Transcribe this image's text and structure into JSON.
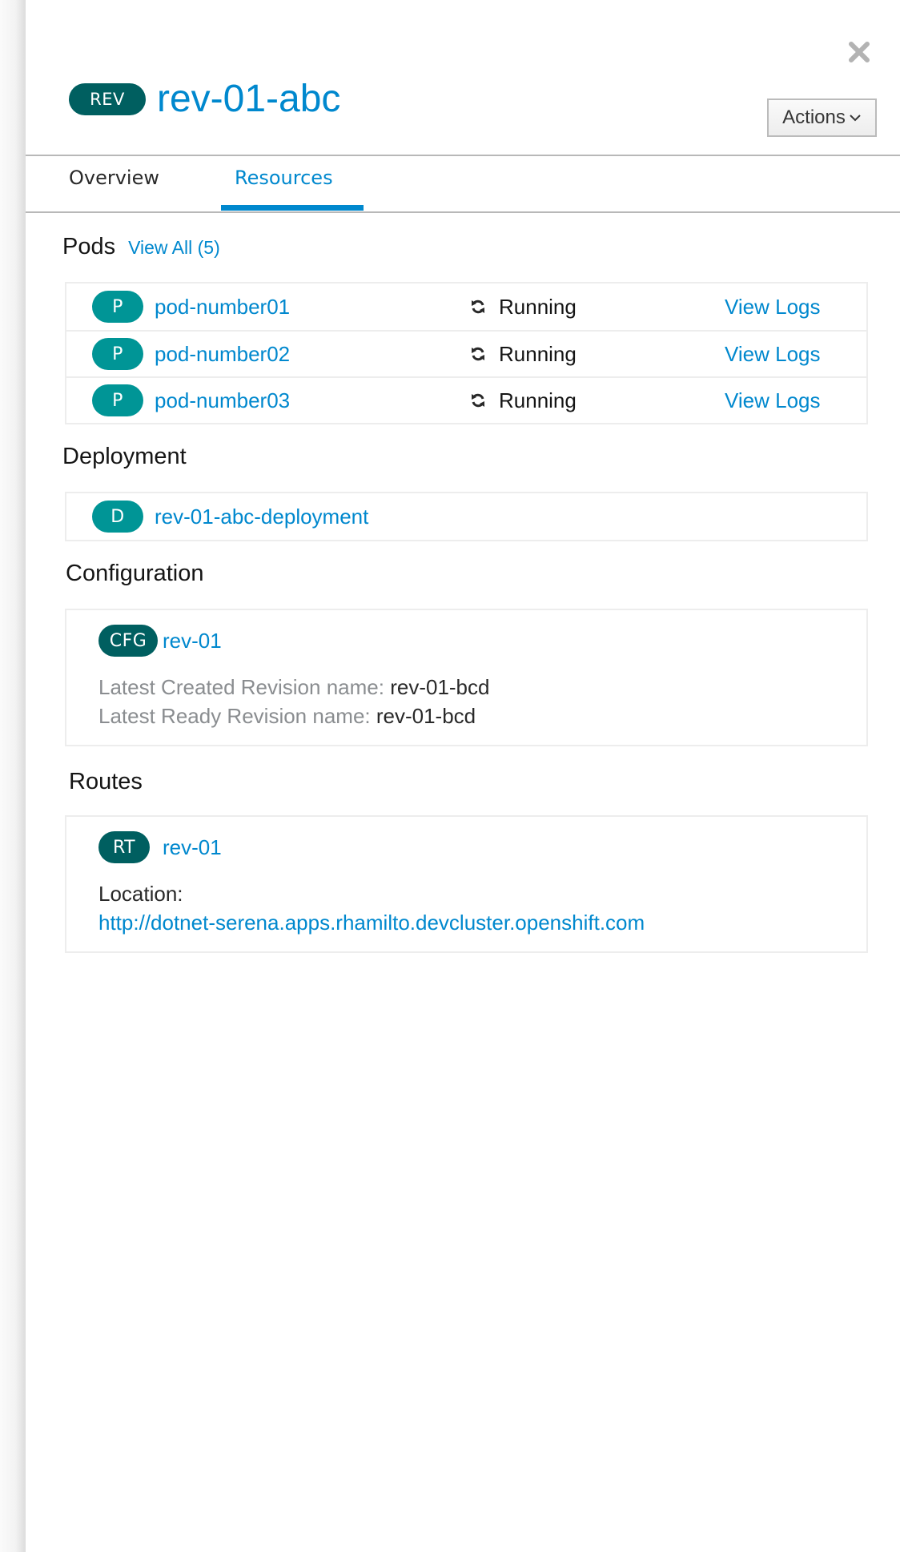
{
  "header": {
    "badge": "REV",
    "title": "rev-01-abc",
    "actions_label": "Actions",
    "close_icon": "close-icon"
  },
  "tabs": [
    {
      "label": "Overview",
      "active": false
    },
    {
      "label": "Resources",
      "active": true
    }
  ],
  "colors": {
    "link": "#0088ce",
    "badge_dark": "#005f60",
    "badge_teal": "#009596",
    "active_tab": "#0088ce"
  },
  "pods": {
    "heading": "Pods",
    "view_all": "View All (5)",
    "items": [
      {
        "badge": "P",
        "name": "pod-number01",
        "status": "Running",
        "status_icon": "sync-icon",
        "action": "View Logs"
      },
      {
        "badge": "P",
        "name": "pod-number02",
        "status": "Running",
        "status_icon": "sync-icon",
        "action": "View Logs"
      },
      {
        "badge": "P",
        "name": "pod-number03",
        "status": "Running",
        "status_icon": "sync-icon",
        "action": "View Logs"
      }
    ]
  },
  "deployment": {
    "heading": "Deployment",
    "badge": "D",
    "name": "rev-01-abc-deployment"
  },
  "configuration": {
    "heading": "Configuration",
    "badge": "CFG",
    "name": "rev-01",
    "fields": [
      {
        "label": "Latest Created Revision name:",
        "value": "rev-01-bcd"
      },
      {
        "label": "Latest Ready Revision name:",
        "value": "rev-01-bcd"
      }
    ]
  },
  "routes": {
    "heading": "Routes",
    "badge": "RT",
    "name": "rev-01",
    "location_label": "Location:",
    "location_url": "http://dotnet-serena.apps.rhamilto.devcluster.openshift.com"
  }
}
